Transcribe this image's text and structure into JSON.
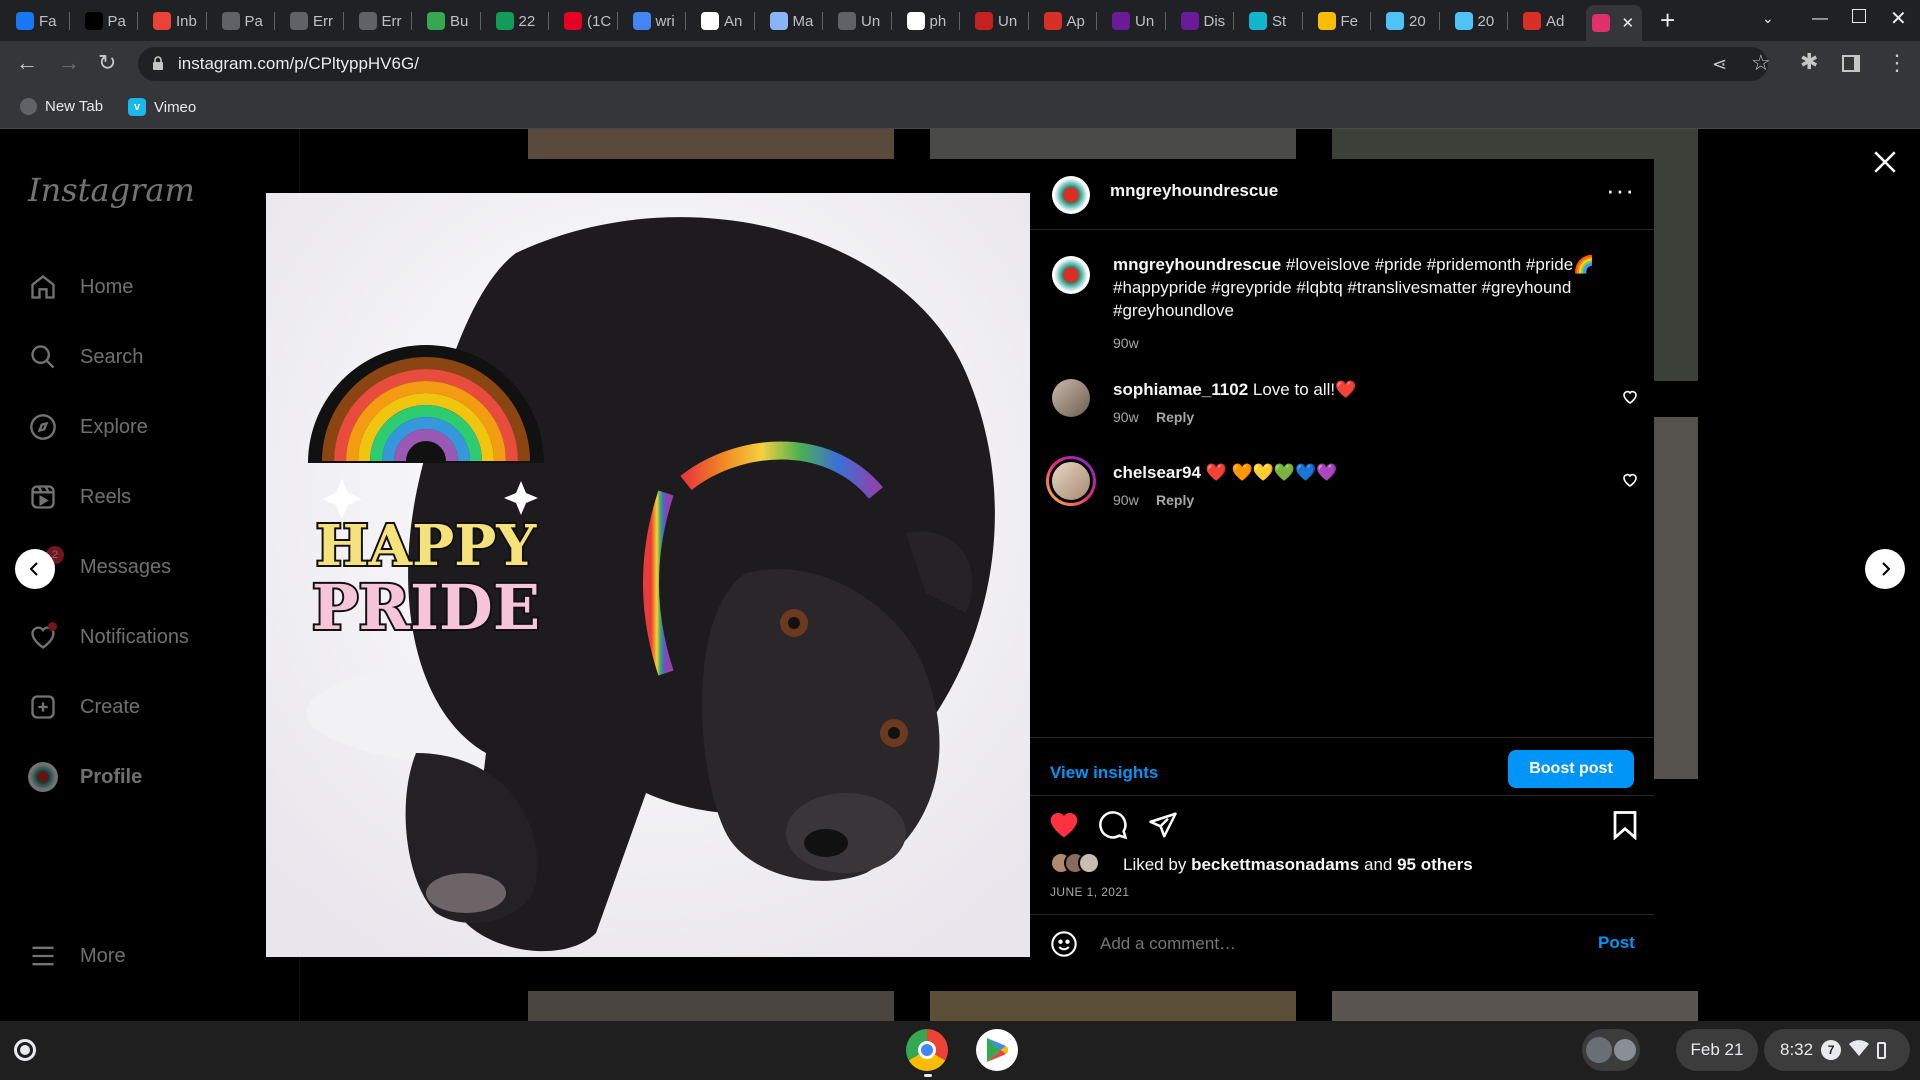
{
  "browser": {
    "tabs": [
      {
        "label": "Fa",
        "icon": "facebook-icon",
        "color": "#1877f2"
      },
      {
        "label": "Pa",
        "icon": "vimeo-icon",
        "color": "#000"
      },
      {
        "label": "Inb",
        "icon": "gmail-icon",
        "color": "#ea4335"
      },
      {
        "label": "Pa",
        "icon": "globe-icon",
        "color": "#5f6368"
      },
      {
        "label": "Err",
        "icon": "globe-icon",
        "color": "#5f6368"
      },
      {
        "label": "Err",
        "icon": "globe-icon",
        "color": "#5f6368"
      },
      {
        "label": "Bu",
        "icon": "bookmark-green-icon",
        "color": "#34a853"
      },
      {
        "label": "22",
        "icon": "plus-green-icon",
        "color": "#0f9d58"
      },
      {
        "label": "(1C",
        "icon": "pinterest-icon",
        "color": "#e60023"
      },
      {
        "label": "wri",
        "icon": "docs-icon",
        "color": "#4285f4"
      },
      {
        "label": "An",
        "icon": "amazon-icon",
        "color": "#fff"
      },
      {
        "label": "Ma",
        "icon": "maps-icon",
        "color": "#8ab4f8"
      },
      {
        "label": "Un",
        "icon": "globe-icon",
        "color": "#5f6368"
      },
      {
        "label": "ph",
        "icon": "google-icon",
        "color": "#fff"
      },
      {
        "label": "Un",
        "icon": "calendar-red-icon",
        "color": "#c5221f"
      },
      {
        "label": "Ap",
        "icon": "shield-red-icon",
        "color": "#d93025"
      },
      {
        "label": "Un",
        "icon": "purple-circle-icon",
        "color": "#6a1b9a"
      },
      {
        "label": "Dis",
        "icon": "purple-circle-icon",
        "color": "#6a1b9a"
      },
      {
        "label": "St",
        "icon": "chart-icon",
        "color": "#12b5cb"
      },
      {
        "label": "Fe",
        "icon": "feather-icon",
        "color": "#fbbc04"
      },
      {
        "label": "20",
        "icon": "ev-icon",
        "color": "#4fc3f7"
      },
      {
        "label": "20",
        "icon": "ev-icon",
        "color": "#4fc3f7"
      },
      {
        "label": "Ad",
        "icon": "rescue-logo-icon",
        "color": "#d93025"
      },
      {
        "label": "",
        "icon": "instagram-icon",
        "color": "#e1306c",
        "active": true
      }
    ],
    "url": "instagram.com/p/CPltyppHV6G/",
    "bookmarks": [
      {
        "label": "New Tab",
        "icon": "globe-icon"
      },
      {
        "label": "Vimeo",
        "icon": "vimeo-icon"
      }
    ]
  },
  "sidebar": {
    "logo": "Instagram",
    "items": [
      {
        "label": "Home",
        "icon": "home-icon"
      },
      {
        "label": "Search",
        "icon": "search-icon"
      },
      {
        "label": "Explore",
        "icon": "compass-icon"
      },
      {
        "label": "Reels",
        "icon": "reels-icon"
      },
      {
        "label": "Messages",
        "icon": "messenger-icon",
        "badge": "2"
      },
      {
        "label": "Notifications",
        "icon": "heart-icon"
      },
      {
        "label": "Create",
        "icon": "plus-square-icon"
      },
      {
        "label": "Profile",
        "icon": "avatar-icon"
      }
    ],
    "more": "More"
  },
  "post": {
    "image_text": {
      "line1": "HAPPY",
      "line2": "PRIDE"
    },
    "author": "mngreyhoundrescue",
    "caption": "#loveislove #pride #pridemonth #pride🌈 #happypride #greypride #lqbtq #translivesmatter #greyhound #greyhoundlove",
    "caption_age": "90w",
    "comments": [
      {
        "user": "sophiamae_1102",
        "text": "Love to all!❤️",
        "age": "90w",
        "reply": "Reply"
      },
      {
        "user": "chelsear94",
        "text": "❤️ 🧡💛💚💙💜",
        "age": "90w",
        "reply": "Reply"
      }
    ],
    "view_insights": "View insights",
    "boost": "Boost post",
    "liked_by_prefix": "Liked by",
    "liked_by_user": "beckettmasonadams",
    "liked_by_and": "and",
    "liked_by_others": "95 others",
    "date": "JUNE 1, 2021",
    "comment_placeholder": "Add a comment…",
    "post_button": "Post",
    "like_color": "#ff3040",
    "link_color": "#0095f6"
  },
  "taskbar": {
    "date": "Feb 21",
    "time": "8:32",
    "notif_count": "7"
  }
}
